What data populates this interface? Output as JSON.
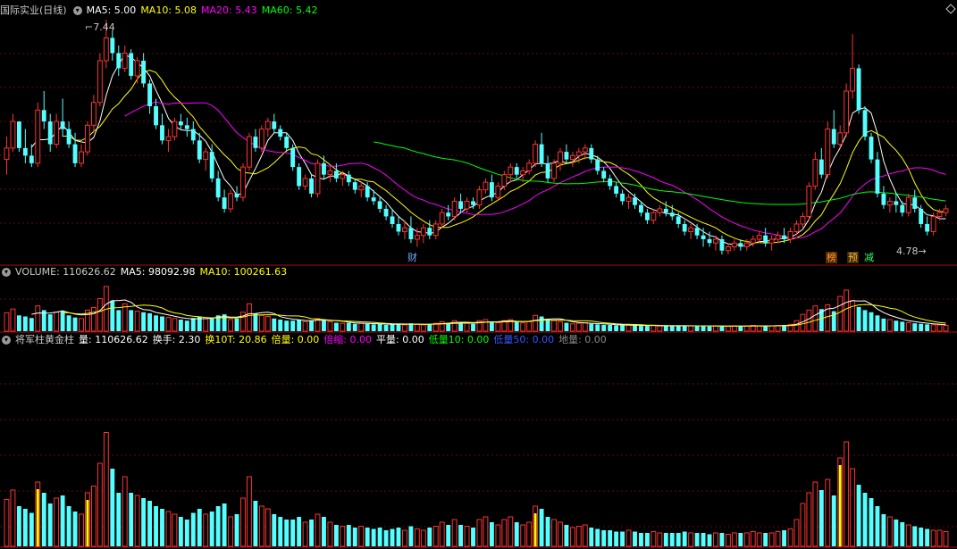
{
  "main": {
    "title": "国际实业(日线)",
    "ma_labels": [
      "MA5: 5.00",
      "MA10: 5.08",
      "MA20: 5.43",
      "MA60: 5.42"
    ],
    "ma_colors": [
      "#ffffff",
      "#ffff00",
      "#ff00ff",
      "#00ff00"
    ],
    "high_label": "7.44",
    "low_label": "4.78",
    "markers": [
      {
        "text": "财",
        "color": "#6fa8ff"
      },
      {
        "text": "榜",
        "color": "#ff9933"
      },
      {
        "text": "预",
        "color": "#ffb84d"
      },
      {
        "text": "减",
        "color": "#33ff66"
      }
    ]
  },
  "volume": {
    "title": "VOLUME: 110626.62",
    "ma5": "MA5: 98092.98",
    "ma10": "MA10: 100261.63"
  },
  "indicator": {
    "name": "将军柱黄金柱",
    "fields": [
      {
        "label": "量: 110626.62",
        "color": "#ffffff"
      },
      {
        "label": "换手: 2.30",
        "color": "#ffffff"
      },
      {
        "label": "换10T: 20.86",
        "color": "#ffff00"
      },
      {
        "label": "倍量: 0.00",
        "color": "#ffff00"
      },
      {
        "label": "倍缩: 0.00",
        "color": "#ff00ff"
      },
      {
        "label": "平量: 0.00",
        "color": "#ffffff"
      },
      {
        "label": "低量10: 0.00",
        "color": "#00ff00"
      },
      {
        "label": "低量50: 0.00",
        "color": "#3355ff"
      },
      {
        "label": "地量: 0.00",
        "color": "#888888"
      }
    ]
  },
  "chart_data": {
    "type": "candlestick",
    "colors": {
      "up": "#ff3232",
      "down": "#54ffff"
    },
    "ohlc": [
      [
        5.6,
        5.9,
        5.4,
        5.75
      ],
      [
        5.75,
        6.2,
        5.7,
        6.1
      ],
      [
        6.1,
        6.1,
        5.7,
        5.75
      ],
      [
        5.75,
        6.0,
        5.55,
        5.65
      ],
      [
        5.65,
        5.8,
        5.5,
        5.55
      ],
      [
        5.55,
        6.35,
        5.5,
        6.25
      ],
      [
        6.25,
        6.5,
        6.0,
        6.1
      ],
      [
        6.1,
        6.2,
        5.7,
        5.8
      ],
      [
        5.8,
        6.2,
        5.75,
        6.1
      ],
      [
        6.1,
        6.4,
        5.9,
        6.0
      ],
      [
        6.0,
        6.1,
        5.75,
        5.8
      ],
      [
        5.8,
        5.95,
        5.5,
        5.55
      ],
      [
        5.55,
        5.8,
        5.5,
        5.7
      ],
      [
        5.7,
        6.1,
        5.65,
        6.05
      ],
      [
        6.05,
        6.45,
        5.95,
        6.35
      ],
      [
        6.35,
        7.0,
        6.3,
        6.9
      ],
      [
        6.9,
        7.44,
        6.8,
        7.2
      ],
      [
        7.2,
        7.3,
        6.9,
        7.0
      ],
      [
        7.0,
        7.1,
        6.7,
        6.8
      ],
      [
        6.8,
        7.1,
        6.75,
        7.0
      ],
      [
        7.0,
        7.05,
        6.65,
        6.7
      ],
      [
        6.7,
        6.95,
        6.6,
        6.9
      ],
      [
        6.9,
        7.0,
        6.55,
        6.6
      ],
      [
        6.6,
        6.65,
        6.2,
        6.3
      ],
      [
        6.3,
        6.4,
        6.0,
        6.05
      ],
      [
        6.05,
        6.2,
        5.8,
        5.85
      ],
      [
        5.85,
        6.0,
        5.7,
        5.9
      ],
      [
        5.9,
        6.15,
        5.85,
        6.1
      ],
      [
        6.1,
        6.2,
        6.0,
        6.05
      ],
      [
        6.05,
        6.15,
        5.9,
        6.0
      ],
      [
        6.0,
        6.1,
        5.8,
        5.85
      ],
      [
        5.85,
        5.95,
        5.55,
        5.6
      ],
      [
        5.6,
        5.75,
        5.45,
        5.7
      ],
      [
        5.7,
        5.8,
        5.3,
        5.35
      ],
      [
        5.35,
        5.45,
        5.05,
        5.1
      ],
      [
        5.1,
        5.2,
        4.9,
        4.95
      ],
      [
        4.95,
        5.2,
        4.9,
        5.15
      ],
      [
        5.15,
        5.25,
        5.05,
        5.1
      ],
      [
        5.1,
        5.55,
        5.05,
        5.5
      ],
      [
        5.5,
        5.95,
        5.45,
        5.9
      ],
      [
        5.9,
        6.0,
        5.7,
        5.75
      ],
      [
        5.75,
        6.05,
        5.7,
        6.0
      ],
      [
        6.0,
        6.15,
        5.9,
        6.1
      ],
      [
        6.1,
        6.2,
        5.95,
        6.0
      ],
      [
        6.0,
        6.05,
        5.85,
        5.9
      ],
      [
        5.9,
        5.95,
        5.7,
        5.75
      ],
      [
        5.75,
        5.8,
        5.45,
        5.5
      ],
      [
        5.5,
        5.55,
        5.2,
        5.25
      ],
      [
        5.25,
        5.4,
        5.2,
        5.35
      ],
      [
        5.35,
        5.4,
        5.1,
        5.15
      ],
      [
        5.15,
        5.6,
        5.1,
        5.55
      ],
      [
        5.55,
        5.65,
        5.35,
        5.4
      ],
      [
        5.4,
        5.5,
        5.3,
        5.45
      ],
      [
        5.45,
        5.55,
        5.3,
        5.35
      ],
      [
        5.35,
        5.45,
        5.25,
        5.4
      ],
      [
        5.4,
        5.45,
        5.25,
        5.3
      ],
      [
        5.3,
        5.35,
        5.15,
        5.2
      ],
      [
        5.2,
        5.3,
        5.1,
        5.25
      ],
      [
        5.25,
        5.3,
        5.05,
        5.1
      ],
      [
        5.1,
        5.2,
        5.0,
        5.05
      ],
      [
        5.05,
        5.1,
        4.9,
        4.95
      ],
      [
        4.95,
        5.0,
        4.8,
        4.85
      ],
      [
        4.85,
        4.95,
        4.7,
        4.75
      ],
      [
        4.75,
        4.85,
        4.6,
        4.65
      ],
      [
        4.65,
        4.8,
        4.55,
        4.7
      ],
      [
        4.7,
        4.85,
        4.5,
        4.55
      ],
      [
        4.55,
        4.7,
        4.45,
        4.6
      ],
      [
        4.6,
        4.75,
        4.5,
        4.7
      ],
      [
        4.7,
        4.8,
        4.55,
        4.6
      ],
      [
        4.6,
        4.8,
        4.55,
        4.75
      ],
      [
        4.75,
        4.95,
        4.7,
        4.9
      ],
      [
        4.9,
        5.0,
        4.8,
        4.85
      ],
      [
        4.85,
        5.1,
        4.8,
        5.05
      ],
      [
        5.05,
        5.15,
        4.9,
        4.95
      ],
      [
        4.95,
        5.1,
        4.9,
        5.05
      ],
      [
        5.05,
        5.1,
        4.95,
        5.0
      ],
      [
        5.0,
        5.25,
        4.95,
        5.2
      ],
      [
        5.2,
        5.35,
        5.15,
        5.3
      ],
      [
        5.3,
        5.4,
        5.05,
        5.1
      ],
      [
        5.1,
        5.3,
        5.05,
        5.25
      ],
      [
        5.25,
        5.45,
        5.2,
        5.4
      ],
      [
        5.4,
        5.55,
        5.3,
        5.5
      ],
      [
        5.5,
        5.55,
        5.35,
        5.4
      ],
      [
        5.4,
        5.5,
        5.3,
        5.45
      ],
      [
        5.45,
        5.6,
        5.4,
        5.55
      ],
      [
        5.55,
        5.85,
        5.5,
        5.8
      ],
      [
        5.8,
        5.95,
        5.5,
        5.55
      ],
      [
        5.55,
        5.65,
        5.3,
        5.35
      ],
      [
        5.35,
        5.6,
        5.3,
        5.55
      ],
      [
        5.55,
        5.75,
        5.45,
        5.7
      ],
      [
        5.7,
        5.8,
        5.55,
        5.6
      ],
      [
        5.6,
        5.7,
        5.5,
        5.65
      ],
      [
        5.65,
        5.75,
        5.55,
        5.7
      ],
      [
        5.7,
        5.8,
        5.6,
        5.75
      ],
      [
        5.75,
        5.8,
        5.55,
        5.6
      ],
      [
        5.6,
        5.65,
        5.4,
        5.45
      ],
      [
        5.45,
        5.5,
        5.3,
        5.35
      ],
      [
        5.35,
        5.4,
        5.2,
        5.25
      ],
      [
        5.25,
        5.3,
        5.1,
        5.15
      ],
      [
        5.15,
        5.2,
        5.0,
        5.05
      ],
      [
        5.05,
        5.15,
        4.95,
        5.1
      ],
      [
        5.1,
        5.15,
        4.95,
        5.0
      ],
      [
        5.0,
        5.05,
        4.85,
        4.9
      ],
      [
        4.9,
        4.95,
        4.75,
        4.8
      ],
      [
        4.8,
        4.95,
        4.75,
        4.9
      ],
      [
        4.9,
        5.0,
        4.85,
        4.95
      ],
      [
        4.95,
        5.05,
        4.85,
        4.9
      ],
      [
        4.9,
        5.0,
        4.8,
        4.85
      ],
      [
        4.85,
        4.9,
        4.7,
        4.75
      ],
      [
        4.75,
        4.8,
        4.6,
        4.65
      ],
      [
        4.65,
        4.75,
        4.55,
        4.7
      ],
      [
        4.7,
        4.75,
        4.55,
        4.6
      ],
      [
        4.6,
        4.7,
        4.45,
        4.55
      ],
      [
        4.55,
        4.65,
        4.45,
        4.5
      ],
      [
        4.5,
        4.6,
        4.4,
        4.55
      ],
      [
        4.55,
        4.6,
        4.35,
        4.4
      ],
      [
        4.4,
        4.5,
        4.35,
        4.45
      ],
      [
        4.45,
        4.55,
        4.4,
        4.5
      ],
      [
        4.5,
        4.55,
        4.4,
        4.45
      ],
      [
        4.45,
        4.55,
        4.4,
        4.5
      ],
      [
        4.5,
        4.6,
        4.45,
        4.55
      ],
      [
        4.55,
        4.65,
        4.5,
        4.6
      ],
      [
        4.6,
        4.7,
        4.45,
        4.5
      ],
      [
        4.5,
        4.6,
        4.4,
        4.55
      ],
      [
        4.55,
        4.65,
        4.5,
        4.6
      ],
      [
        4.6,
        4.7,
        4.5,
        4.55
      ],
      [
        4.55,
        4.7,
        4.5,
        4.65
      ],
      [
        4.65,
        4.8,
        4.6,
        4.75
      ],
      [
        4.75,
        4.9,
        4.7,
        4.85
      ],
      [
        4.85,
        5.3,
        4.8,
        5.25
      ],
      [
        5.25,
        5.7,
        5.2,
        5.6
      ],
      [
        5.6,
        5.75,
        5.35,
        5.4
      ],
      [
        5.4,
        6.1,
        5.35,
        6.0
      ],
      [
        6.0,
        6.25,
        5.75,
        5.8
      ],
      [
        5.8,
        6.05,
        5.75,
        5.95
      ],
      [
        5.95,
        6.6,
        5.9,
        6.5
      ],
      [
        6.5,
        7.25,
        6.4,
        6.8
      ],
      [
        6.8,
        6.85,
        6.2,
        6.25
      ],
      [
        6.25,
        6.3,
        5.85,
        5.9
      ],
      [
        5.9,
        5.95,
        5.55,
        5.6
      ],
      [
        5.6,
        5.7,
        5.1,
        5.15
      ],
      [
        5.15,
        5.25,
        4.95,
        5.0
      ],
      [
        5.0,
        5.1,
        4.9,
        5.05
      ],
      [
        5.05,
        5.15,
        4.9,
        5.0
      ],
      [
        5.0,
        5.05,
        4.85,
        4.9
      ],
      [
        4.9,
        5.15,
        4.85,
        5.1
      ],
      [
        5.1,
        5.2,
        4.9,
        4.95
      ],
      [
        4.95,
        5.0,
        4.7,
        4.75
      ],
      [
        4.75,
        4.85,
        4.6,
        4.65
      ],
      [
        4.65,
        4.9,
        4.6,
        4.85
      ],
      [
        4.85,
        4.95,
        4.8,
        4.9
      ],
      [
        4.9,
        5.0,
        4.85,
        4.95
      ]
    ],
    "volume_scale_max": 1.0,
    "volume": [
      0.35,
      0.42,
      0.3,
      0.28,
      0.25,
      0.48,
      0.4,
      0.32,
      0.36,
      0.38,
      0.3,
      0.26,
      0.24,
      0.4,
      0.45,
      0.62,
      0.85,
      0.58,
      0.4,
      0.52,
      0.4,
      0.38,
      0.36,
      0.34,
      0.3,
      0.28,
      0.26,
      0.24,
      0.22,
      0.2,
      0.25,
      0.28,
      0.24,
      0.26,
      0.3,
      0.32,
      0.22,
      0.24,
      0.36,
      0.52,
      0.34,
      0.3,
      0.28,
      0.24,
      0.22,
      0.2,
      0.2,
      0.22,
      0.18,
      0.2,
      0.24,
      0.22,
      0.18,
      0.16,
      0.15,
      0.16,
      0.14,
      0.15,
      0.14,
      0.13,
      0.14,
      0.12,
      0.13,
      0.14,
      0.12,
      0.15,
      0.13,
      0.12,
      0.14,
      0.15,
      0.18,
      0.16,
      0.2,
      0.16,
      0.15,
      0.14,
      0.2,
      0.22,
      0.18,
      0.16,
      0.2,
      0.22,
      0.18,
      0.16,
      0.18,
      0.3,
      0.28,
      0.22,
      0.2,
      0.18,
      0.16,
      0.14,
      0.15,
      0.16,
      0.14,
      0.13,
      0.12,
      0.12,
      0.11,
      0.11,
      0.12,
      0.11,
      0.1,
      0.1,
      0.11,
      0.1,
      0.1,
      0.1,
      0.1,
      0.11,
      0.1,
      0.1,
      0.1,
      0.09,
      0.1,
      0.1,
      0.09,
      0.1,
      0.1,
      0.1,
      0.11,
      0.1,
      0.1,
      0.1,
      0.11,
      0.12,
      0.13,
      0.2,
      0.32,
      0.4,
      0.48,
      0.42,
      0.5,
      0.38,
      0.66,
      0.78,
      0.58,
      0.46,
      0.4,
      0.36,
      0.3,
      0.24,
      0.22,
      0.2,
      0.18,
      0.16,
      0.15,
      0.14,
      0.13,
      0.12,
      0.12,
      0.11
    ]
  }
}
